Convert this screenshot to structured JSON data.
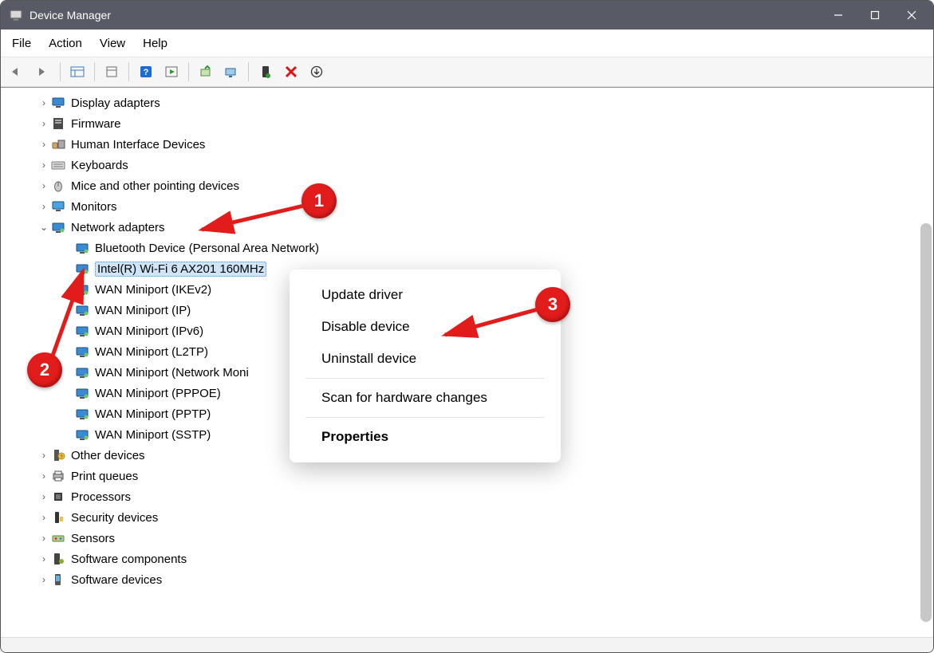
{
  "window": {
    "title": "Device Manager"
  },
  "menu": {
    "file": "File",
    "action": "Action",
    "view": "View",
    "help": "Help"
  },
  "tree": {
    "categories": [
      {
        "icon": "display",
        "label": "Display adapters",
        "expanded": false
      },
      {
        "icon": "firmware",
        "label": "Firmware",
        "expanded": false
      },
      {
        "icon": "hid",
        "label": "Human Interface Devices",
        "expanded": false
      },
      {
        "icon": "keyboard",
        "label": "Keyboards",
        "expanded": false
      },
      {
        "icon": "mouse",
        "label": "Mice and other pointing devices",
        "expanded": false
      },
      {
        "icon": "monitor",
        "label": "Monitors",
        "expanded": false
      },
      {
        "icon": "network",
        "label": "Network adapters",
        "expanded": true,
        "children": [
          {
            "label": "Bluetooth Device (Personal Area Network)"
          },
          {
            "label": "Intel(R) Wi-Fi 6 AX201 160MHz",
            "selected": true
          },
          {
            "label": "WAN Miniport (IKEv2)"
          },
          {
            "label": "WAN Miniport (IP)"
          },
          {
            "label": "WAN Miniport (IPv6)"
          },
          {
            "label": "WAN Miniport (L2TP)"
          },
          {
            "label": "WAN Miniport (Network Moni"
          },
          {
            "label": "WAN Miniport (PPPOE)"
          },
          {
            "label": "WAN Miniport (PPTP)"
          },
          {
            "label": "WAN Miniport (SSTP)"
          }
        ]
      },
      {
        "icon": "other",
        "label": "Other devices",
        "expanded": false
      },
      {
        "icon": "printer",
        "label": "Print queues",
        "expanded": false
      },
      {
        "icon": "cpu",
        "label": "Processors",
        "expanded": false
      },
      {
        "icon": "security",
        "label": "Security devices",
        "expanded": false
      },
      {
        "icon": "sensor",
        "label": "Sensors",
        "expanded": false
      },
      {
        "icon": "swcomp",
        "label": "Software components",
        "expanded": false
      },
      {
        "icon": "swdev",
        "label": "Software devices",
        "expanded": false
      }
    ]
  },
  "context_menu": {
    "items": [
      {
        "label": "Update driver"
      },
      {
        "label": "Disable device"
      },
      {
        "label": "Uninstall device"
      },
      {
        "separator": true
      },
      {
        "label": "Scan for hardware changes"
      },
      {
        "separator": true
      },
      {
        "label": "Properties",
        "bold": true
      }
    ]
  },
  "annotations": {
    "1": "1",
    "2": "2",
    "3": "3"
  }
}
